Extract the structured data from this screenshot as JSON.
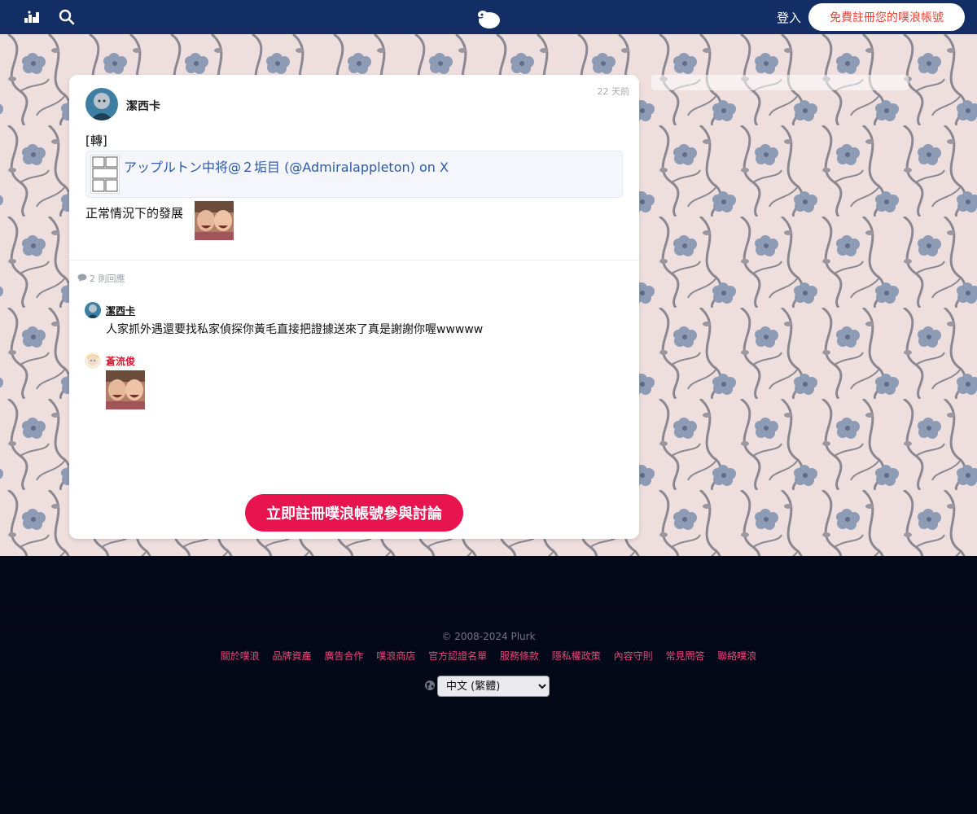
{
  "topbar": {
    "icons": [
      "stats-icon",
      "search-icon",
      "plurk-logo-icon"
    ],
    "login_label": "登入",
    "signup_label": "免費註冊您的噗浪帳號"
  },
  "post": {
    "author": "潔西卡",
    "time": "22 天前",
    "repost_tag": "[轉]",
    "link_title": "アップルトン中将@２垢目 (@Admiralappleton) on X",
    "text": "正常情況下的發展"
  },
  "replies": {
    "count_label": "2 則回應",
    "items": [
      {
        "name": "潔西卡",
        "text": "人家抓外遇還要找私家偵探你黃毛直接把證據送來了真是謝謝你喔wwwww"
      },
      {
        "name": "蒼流俊",
        "text": ""
      }
    ]
  },
  "cta_label": "立即註冊噗浪帳號參與討論",
  "footer": {
    "copyright": "© 2008-2024 Plurk",
    "links": [
      "關於噗浪",
      "品牌資產",
      "廣告合作",
      "噗浪商店",
      "官方認證名單",
      "服務條款",
      "隱私權政策",
      "內容守則",
      "常見問答",
      "聯絡噗浪"
    ],
    "language": "中文 (繁體)"
  },
  "colors": {
    "topbar": "#132e65",
    "accent": "#e8144f",
    "link": "#2d5ba8",
    "footer_link": "#e8467a"
  }
}
